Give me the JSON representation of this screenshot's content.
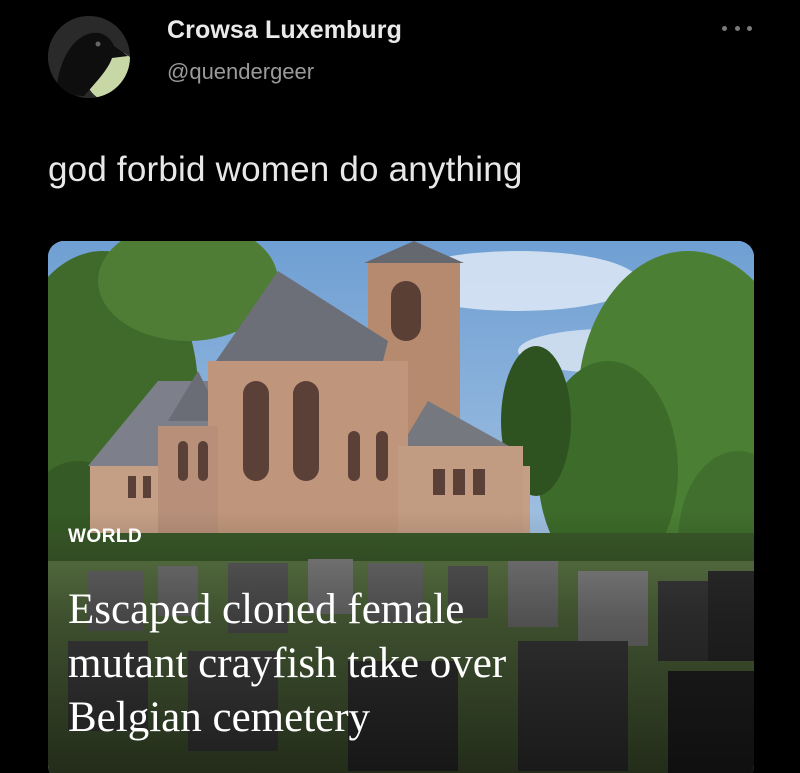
{
  "author": {
    "display_name": "Crowsa Luxemburg",
    "handle": "@quendergeer",
    "avatar_icon": "crow-avatar"
  },
  "menu": {
    "icon": "more-options-icon"
  },
  "tweet": {
    "text": "god forbid women do anything"
  },
  "card": {
    "section": "WORLD",
    "headline": "Escaped cloned female\nmutant crayfish take over\nBelgian cemetery",
    "image_icon": "church-cemetery-photo"
  },
  "colors": {
    "background": "#000000",
    "name": "#eaeaea",
    "handle": "#9a9a9a",
    "body_text": "#e8e8e8"
  }
}
